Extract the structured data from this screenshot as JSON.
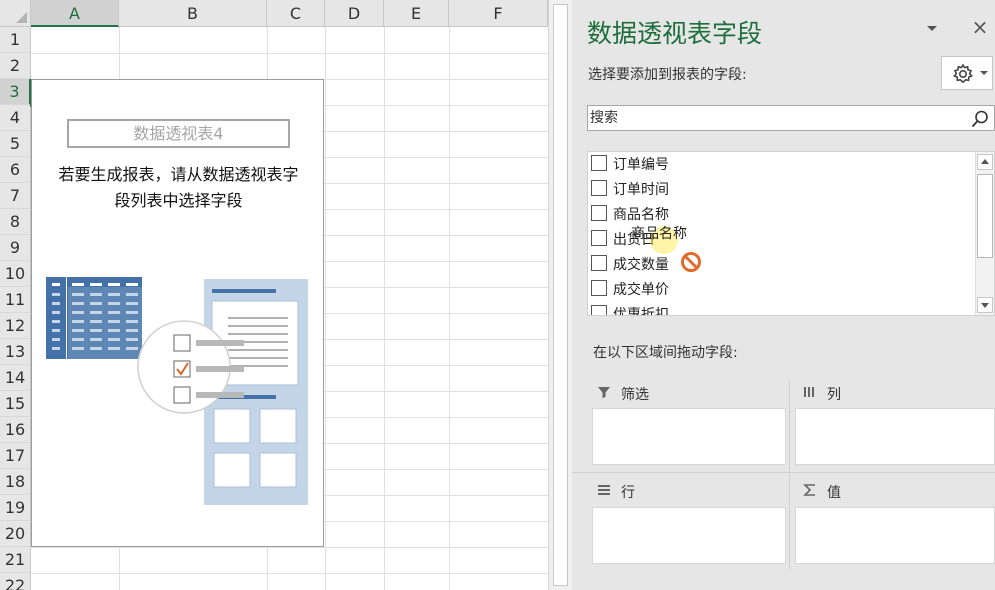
{
  "sheet": {
    "columns": [
      "A",
      "B",
      "C",
      "D",
      "E",
      "F"
    ],
    "rows": [
      "1",
      "2",
      "3",
      "4",
      "5",
      "6",
      "7",
      "8",
      "9",
      "10",
      "11",
      "12",
      "13",
      "14",
      "15",
      "16",
      "17",
      "18",
      "19",
      "20",
      "21",
      "22"
    ]
  },
  "pivot": {
    "name": "数据透视表4",
    "hint": "若要生成报表，请从数据透视表字\n段列表中选择字段"
  },
  "pane": {
    "title": "数据透视表字段",
    "subtitle": "选择要添加到报表的字段:",
    "search_placeholder": "搜索",
    "close_symbol": "×",
    "fields": [
      "订单编号",
      "订单时间",
      "商品名称",
      "出货日",
      "成交数量",
      "成交单价",
      "优惠折扣"
    ],
    "drag_label": "商品名称",
    "areas_label": "在以下区域间拖动字段:",
    "areas": {
      "filter": "筛选",
      "columns": "列",
      "rows": "行",
      "values": "值"
    }
  },
  "colors": {
    "accent": "#217346",
    "title": "#1e6e3c",
    "pivot_table_blue": "#4472a8",
    "pivot_panel_blue": "#c5d5e8",
    "no_drop": "#e06b2a"
  },
  "icons": [
    "gear-icon",
    "chevron-down-icon",
    "close-icon",
    "search-icon",
    "filter-icon",
    "columns-icon",
    "rows-icon",
    "sigma-icon",
    "no-drop-icon"
  ]
}
